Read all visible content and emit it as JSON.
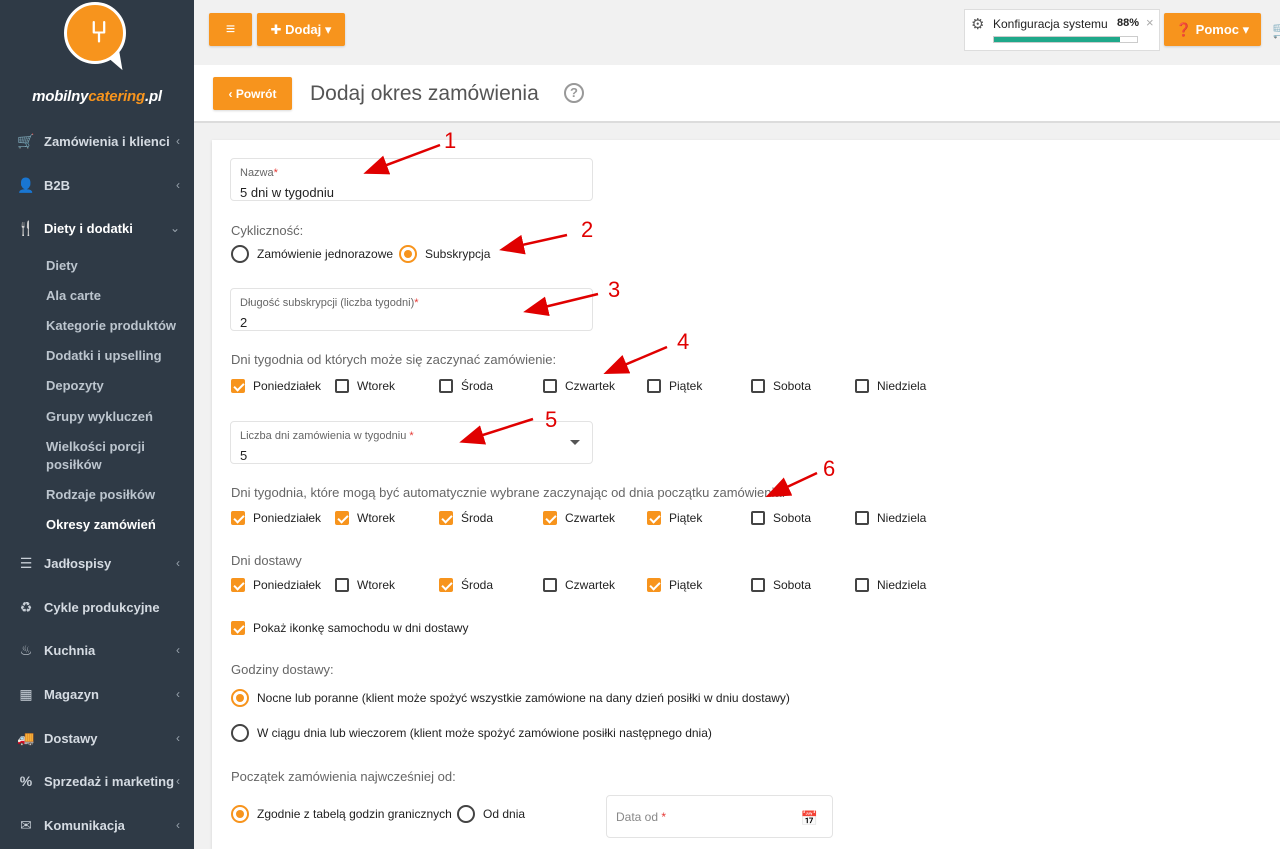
{
  "brand": {
    "name_prefix": "mobilny",
    "name_accent": "catering",
    "name_suffix": ".pl"
  },
  "sidebar": {
    "items": [
      {
        "label": "Zamówienia i klienci",
        "icon": "cart-icon",
        "chevron": "‹"
      },
      {
        "label": "B2B",
        "icon": "user-tie-icon",
        "chevron": "‹"
      },
      {
        "label": "Diety i dodatki",
        "icon": "utensils-icon",
        "chevron": "⌄"
      },
      {
        "label": "Jadłospisy",
        "icon": "list-icon",
        "chevron": "‹"
      },
      {
        "label": "Cykle produkcyjne",
        "icon": "recycle-icon",
        "chevron": ""
      },
      {
        "label": "Kuchnia",
        "icon": "chef-hat-icon",
        "chevron": "‹"
      },
      {
        "label": "Magazyn",
        "icon": "boxes-icon",
        "chevron": "‹"
      },
      {
        "label": "Dostawy",
        "icon": "truck-icon",
        "chevron": "‹"
      },
      {
        "label": "Sprzedaż i marketing",
        "icon": "percent-icon",
        "chevron": "‹"
      },
      {
        "label": "Komunikacja",
        "icon": "envelope-icon",
        "chevron": "‹"
      }
    ],
    "subitems": [
      "Diety",
      "Ala carte",
      "Kategorie produktów",
      "Dodatki i upselling",
      "Depozyty",
      "Grupy wykluczeń",
      "Wielkości porcji posiłków",
      "Rodzaje posiłków",
      "Okresy zamówień"
    ]
  },
  "topbar": {
    "menu_label": "≡",
    "add_label": "✚ Dodaj ▾",
    "config_label": "Konfiguracja systemu",
    "config_percent": "88%",
    "config_progress": 0.88,
    "close_label": "×",
    "help_label": "❓ Pomoc ▾"
  },
  "header": {
    "back_label": "‹ Powrót",
    "title": "Dodaj okres zamówienia",
    "help_icon": "?"
  },
  "form": {
    "name": {
      "label": "Nazwa",
      "required": "*",
      "value": "5 dni w tygodniu"
    },
    "cyclicality": {
      "label": "Cykliczność:",
      "options": [
        {
          "label": "Zamówienie jednorazowe",
          "selected": false
        },
        {
          "label": "Subskrypcja",
          "selected": true
        }
      ]
    },
    "subscription_length": {
      "label": "Długość subskrypcji (liczba tygodni)",
      "required": "*",
      "value": "2"
    },
    "start_days": {
      "label": "Dni tygodnia od których może się zaczynać zamówienie:",
      "days": [
        {
          "label": "Poniedziałek",
          "checked": true
        },
        {
          "label": "Wtorek",
          "checked": false
        },
        {
          "label": "Środa",
          "checked": false
        },
        {
          "label": "Czwartek",
          "checked": false
        },
        {
          "label": "Piątek",
          "checked": false
        },
        {
          "label": "Sobota",
          "checked": false
        },
        {
          "label": "Niedziela",
          "checked": false
        }
      ]
    },
    "days_per_week": {
      "label": "Liczba dni zamówienia w tygodniu",
      "required": "*",
      "value": "5"
    },
    "auto_days": {
      "label": "Dni tygodnia, które mogą być automatycznie wybrane zaczynając od dnia początku zamówienia:",
      "days": [
        {
          "label": "Poniedziałek",
          "checked": true
        },
        {
          "label": "Wtorek",
          "checked": true
        },
        {
          "label": "Środa",
          "checked": true
        },
        {
          "label": "Czwartek",
          "checked": true
        },
        {
          "label": "Piątek",
          "checked": true
        },
        {
          "label": "Sobota",
          "checked": false
        },
        {
          "label": "Niedziela",
          "checked": false
        }
      ]
    },
    "delivery_days": {
      "label": "Dni dostawy",
      "days": [
        {
          "label": "Poniedziałek",
          "checked": true
        },
        {
          "label": "Wtorek",
          "checked": false
        },
        {
          "label": "Środa",
          "checked": true
        },
        {
          "label": "Czwartek",
          "checked": false
        },
        {
          "label": "Piątek",
          "checked": true
        },
        {
          "label": "Sobota",
          "checked": false
        },
        {
          "label": "Niedziela",
          "checked": false
        }
      ]
    },
    "show_truck": {
      "label": "Pokaż ikonkę samochodu w dni dostawy",
      "checked": true
    },
    "delivery_hours": {
      "label": "Godziny dostawy:",
      "options": [
        {
          "label": "Nocne lub poranne (klient może spożyć wszystkie zamówione na dany dzień posiłki w dniu dostawy)",
          "selected": true
        },
        {
          "label": "W ciągu dnia lub wieczorem (klient może spożyć zamówione posiłki następnego dnia)",
          "selected": false
        }
      ]
    },
    "earliest_start": {
      "label": "Początek zamówienia najwcześniej od:",
      "options": [
        {
          "label": "Zgodnie z tabelą godzin granicznych",
          "selected": true
        },
        {
          "label": "Od dnia",
          "selected": false
        }
      ],
      "date_placeholder": "Data od",
      "date_required": "*"
    }
  },
  "annotations": [
    "1",
    "2",
    "3",
    "4",
    "5",
    "6"
  ],
  "colors": {
    "accent": "#f7941d",
    "sidebar": "#2f3a46",
    "progress": "#1fa88a",
    "annotation": "#e00000"
  }
}
